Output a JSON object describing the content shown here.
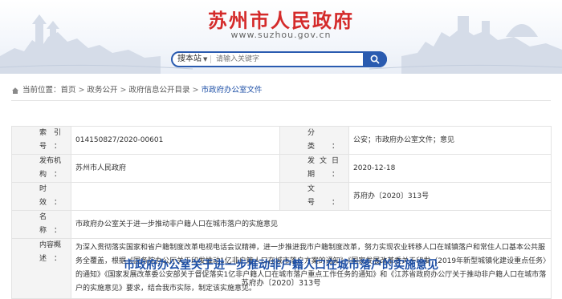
{
  "header": {
    "site_title": "苏州市人民政府",
    "site_domain": "www.suzhou.gov.cn",
    "colors": {
      "title": "#d42a2a",
      "accent": "#2a5bb0",
      "link": "#1d4fa6"
    }
  },
  "search": {
    "scope_label": "搜本站",
    "placeholder": "请输入关键字",
    "button_icon": "search-icon"
  },
  "breadcrumb": {
    "icon": "home-icon",
    "items": [
      "当前位置：",
      "首页",
      "政务公开",
      "政府信息公开目录",
      "市政府办公室文件"
    ],
    "separator": ">"
  },
  "meta": {
    "index_label": "索 引 号：",
    "index_value": "014150827/2020-00601",
    "category_label": "分　　类：",
    "category_value": "公安；市政府办公室文件；意见",
    "publisher_label": "发布机构：",
    "publisher_value": "苏州市人民政府",
    "date_label": "发文日期：",
    "date_value": "2020-12-18",
    "validity_label": "时　　效：",
    "validity_value": "",
    "docno_label": "文　　号：",
    "docno_value": "苏府办〔2020〕313号",
    "title_label": "名　　称：",
    "title_value": "市政府办公室关于进一步推动非户籍人口在城市落户的实施意见",
    "summary_label": "内容概述：",
    "summary_value": "为深入贯彻落实国家和省户籍制度改革电视电话会议精神，进一步推进我市户籍制度改革，努力实现农业转移人口在城镇落户和常住人口基本公共服务全覆盖，根据《国务院办公厅关于印发推动1亿非户籍人口在城市落户方案的通知》《国家发展改革委关于印发〈2019年新型城镇化建设重点任务〉的通知》《国家发展改革委公安部关于督促落实1亿非户籍人口在城市落户重点工作任务的通知》和《江苏省政府办公厅关于推动非户籍人口在城市落户的实施意见》要求，结合我市实际，制定该实施意见。"
  },
  "document": {
    "title": "市政府办公室关于进一步推动非户籍人口在城市落户的实施意见",
    "number": "苏府办〔2020〕313号"
  }
}
